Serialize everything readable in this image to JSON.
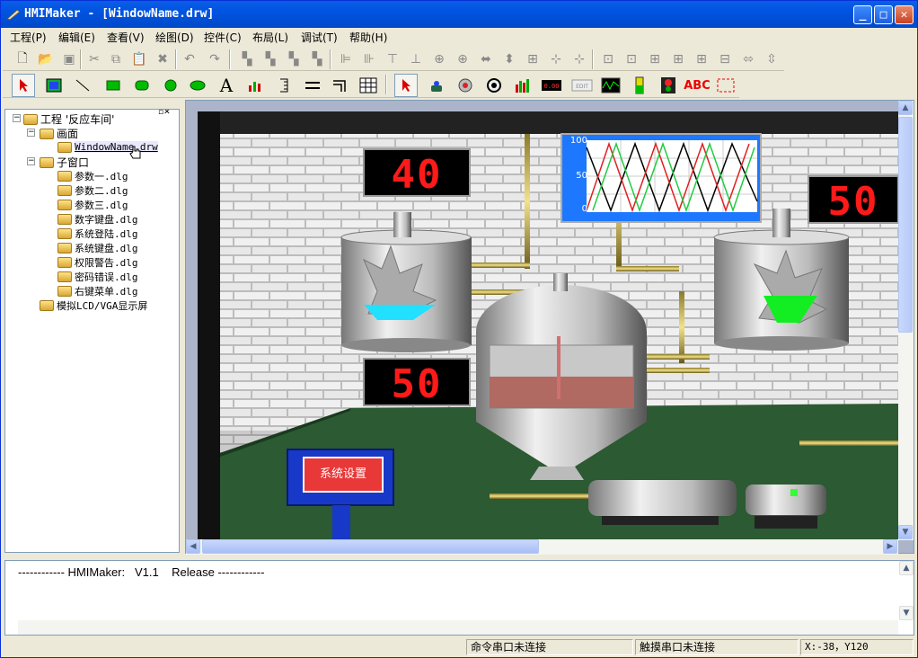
{
  "window": {
    "title": "HMIMaker - [WindowName.drw]",
    "minimize": "_",
    "maximize": "□",
    "close": "✕"
  },
  "menu": [
    "工程(P)",
    "编辑(E)",
    "查看(V)",
    "绘图(D)",
    "控件(C)",
    "布局(L)",
    "调试(T)",
    "帮助(H)"
  ],
  "toolbar2": {
    "text_tool": "A",
    "abc_tool": "ABC"
  },
  "tree": {
    "root": "工程 '反应车间'",
    "screens_folder": "画面",
    "screen_file": "WindowName.drw",
    "subwindow_folder": "子窗口",
    "subwindows": [
      "参数一.dlg",
      "参数二.dlg",
      "参数三.dlg",
      "数字键盘.dlg",
      "系统登陆.dlg",
      "系统键盘.dlg",
      "权限警告.dlg",
      "密码错误.dlg",
      "右键菜单.dlg"
    ],
    "lcd_node": "模拟LCD/VGA显示屏"
  },
  "scene": {
    "display_top_left": "40",
    "display_top_right": "50",
    "display_bottom_left": "50",
    "trend_ticks": [
      "100",
      "50",
      "0"
    ],
    "settings_button": "系统设置"
  },
  "output": {
    "line": "------------ HMIMaker:   V1.1    Release ------------"
  },
  "status": {
    "cmd_port": "命令串口未连接",
    "touch_port": "触摸串口未连接",
    "coords": "X:-38，Y120"
  },
  "colors": {
    "title_blue": "#0053e1",
    "seg_red": "#ff1a1a",
    "trend_bg": "#1e78ff",
    "floor_green": "#2c5a32"
  }
}
